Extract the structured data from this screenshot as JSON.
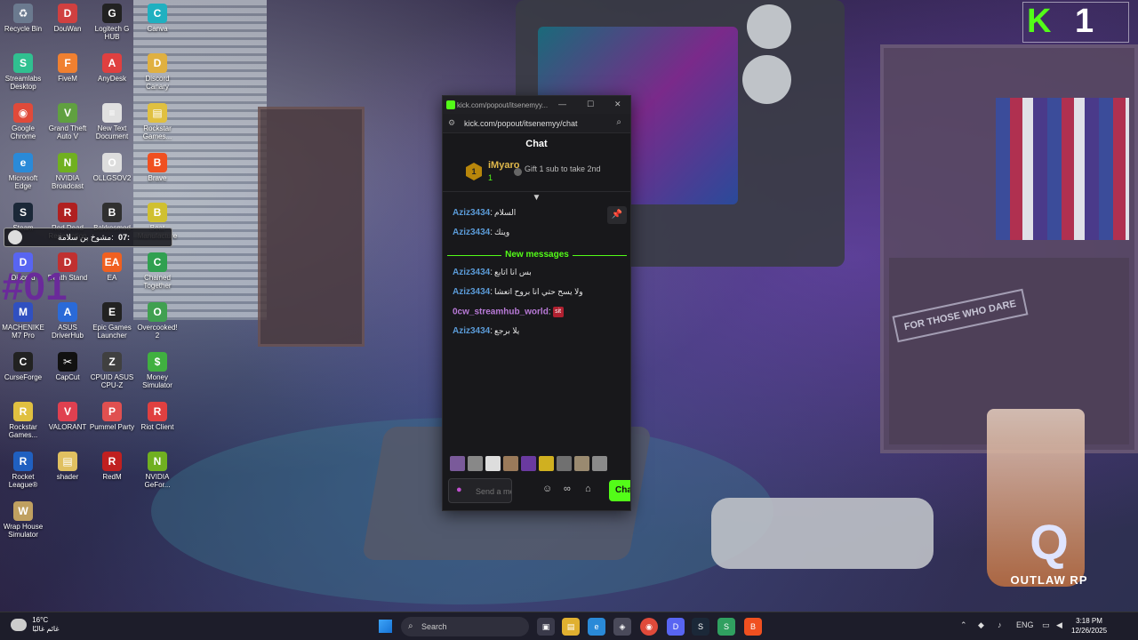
{
  "desktop": {
    "icons": [
      {
        "label": "Recycle Bin",
        "color": "#6b7a8f",
        "glyph": "♻"
      },
      {
        "label": "DouWan",
        "color": "#d04040",
        "glyph": "D"
      },
      {
        "label": "Logitech G HUB",
        "color": "#222222",
        "glyph": "G"
      },
      {
        "label": "Canva",
        "color": "#20b0c0",
        "glyph": "C"
      },
      {
        "label": "Streamlabs Desktop",
        "color": "#30c090",
        "glyph": "S"
      },
      {
        "label": "FiveM",
        "color": "#f08030",
        "glyph": "F"
      },
      {
        "label": "AnyDesk",
        "color": "#e04040",
        "glyph": "A"
      },
      {
        "label": "Discord Canary",
        "color": "#e0b040",
        "glyph": "D"
      },
      {
        "label": "Google Chrome",
        "color": "#e04a3a",
        "glyph": "◉"
      },
      {
        "label": "Grand Theft Auto V",
        "color": "#60a040",
        "glyph": "V"
      },
      {
        "label": "New Text Document",
        "color": "#e0e0e0",
        "glyph": "≡"
      },
      {
        "label": "Rockstar Games...",
        "color": "#e0c040",
        "glyph": "▤"
      },
      {
        "label": "Microsoft Edge",
        "color": "#2a8ad8",
        "glyph": "e"
      },
      {
        "label": "NVIDIA Broadcast",
        "color": "#70b020",
        "glyph": "N"
      },
      {
        "label": "OLLGSOV2",
        "color": "#dddddd",
        "glyph": "O"
      },
      {
        "label": "Brave",
        "color": "#f05020",
        "glyph": "B"
      },
      {
        "label": "Steam",
        "color": "#1b2838",
        "glyph": "S"
      },
      {
        "label": "Red Dead Redemption",
        "color": "#b02020",
        "glyph": "R"
      },
      {
        "label": "Bakkesmod",
        "color": "#303030",
        "glyph": "B"
      },
      {
        "label": "Beat Manufacture",
        "color": "#d0c030",
        "glyph": "B"
      },
      {
        "label": "Discord",
        "color": "#5865f2",
        "glyph": "D"
      },
      {
        "label": "Death Stand",
        "color": "#c03030",
        "glyph": "D"
      },
      {
        "label": "EA",
        "color": "#f06020",
        "glyph": "EA"
      },
      {
        "label": "Chained Together",
        "color": "#30a050",
        "glyph": "C"
      },
      {
        "label": "MACHENIKE M7 Pro",
        "color": "#3050c0",
        "glyph": "M"
      },
      {
        "label": "ASUS DriverHub",
        "color": "#2a6ad8",
        "glyph": "A"
      },
      {
        "label": "Epic Games Launcher",
        "color": "#222222",
        "glyph": "E"
      },
      {
        "label": "Overcooked! 2",
        "color": "#40a050",
        "glyph": "O"
      },
      {
        "label": "CurseForge",
        "color": "#222222",
        "glyph": "C"
      },
      {
        "label": "CapCut",
        "color": "#111111",
        "glyph": "✂"
      },
      {
        "label": "CPUID ASUS CPU-Z",
        "color": "#404040",
        "glyph": "Z"
      },
      {
        "label": "Money Simulator",
        "color": "#40b040",
        "glyph": "$"
      },
      {
        "label": "Rockstar Games...",
        "color": "#e0c040",
        "glyph": "R"
      },
      {
        "label": "VALORANT",
        "color": "#e04050",
        "glyph": "V"
      },
      {
        "label": "Pummel Party",
        "color": "#e05050",
        "glyph": "P"
      },
      {
        "label": "Riot Client",
        "color": "#e04040",
        "glyph": "R"
      },
      {
        "label": "Rocket League®",
        "color": "#2060c0",
        "glyph": "R"
      },
      {
        "label": "shader",
        "color": "#e0c060",
        "glyph": "▤"
      },
      {
        "label": "RedM",
        "color": "#c02020",
        "glyph": "R"
      },
      {
        "label": "NVIDIA GeFor...",
        "color": "#70b020",
        "glyph": "N"
      },
      {
        "label": "Wrap House Simulator",
        "color": "#c0a060",
        "glyph": "W"
      }
    ]
  },
  "media_widget": {
    "title": "مشوخ بن سلامة:",
    "time": "07:"
  },
  "overlay_tag": "#01",
  "kick_logo": {
    "k": "K",
    "number": "1"
  },
  "outlaw": {
    "mark": "Q",
    "name": "OUTLAW RP"
  },
  "wallpaper_sign": "FOR THOSE WHO DARE",
  "chat_window": {
    "tab_title": "kick.com/popout/itsenemyy...",
    "url": "kick.com/popout/itsenemyy/chat",
    "heading": "Chat",
    "gift_banner": {
      "rank": "1",
      "username": "iMyaro",
      "count": "1",
      "message": "Gift 1 sub to take 2nd"
    },
    "messages_before": [
      {
        "user": "Aziz3434",
        "text": "السلام"
      },
      {
        "user": "Aziz3434",
        "text": "وينك"
      }
    ],
    "divider_label": "New messages",
    "messages_after": [
      {
        "user": "Aziz3434",
        "text": "بس انا اتابع"
      },
      {
        "user": "Aziz3434",
        "text": "ولا يسح حتي انا بروح اتعشا"
      },
      {
        "user": "0cw_streamhub_world",
        "text": "",
        "emote": "sit"
      },
      {
        "user": "Aziz3434",
        "text": "يلا برجع"
      }
    ],
    "input_placeholder": "Send a message",
    "send_label": "Chat",
    "emote_colors": [
      "#7a5a9a",
      "#888888",
      "#dddddd",
      "#9a7a5a",
      "#6a3aa0",
      "#d0b020",
      "#707070",
      "#9a8a70",
      "#8a8a8a"
    ]
  },
  "taskbar": {
    "temperature": "16°C",
    "weather_desc": "غائم غالبًا",
    "search_label": "Search",
    "language": "ENG",
    "time": "3:18 PM",
    "date": "12/26/2025"
  }
}
